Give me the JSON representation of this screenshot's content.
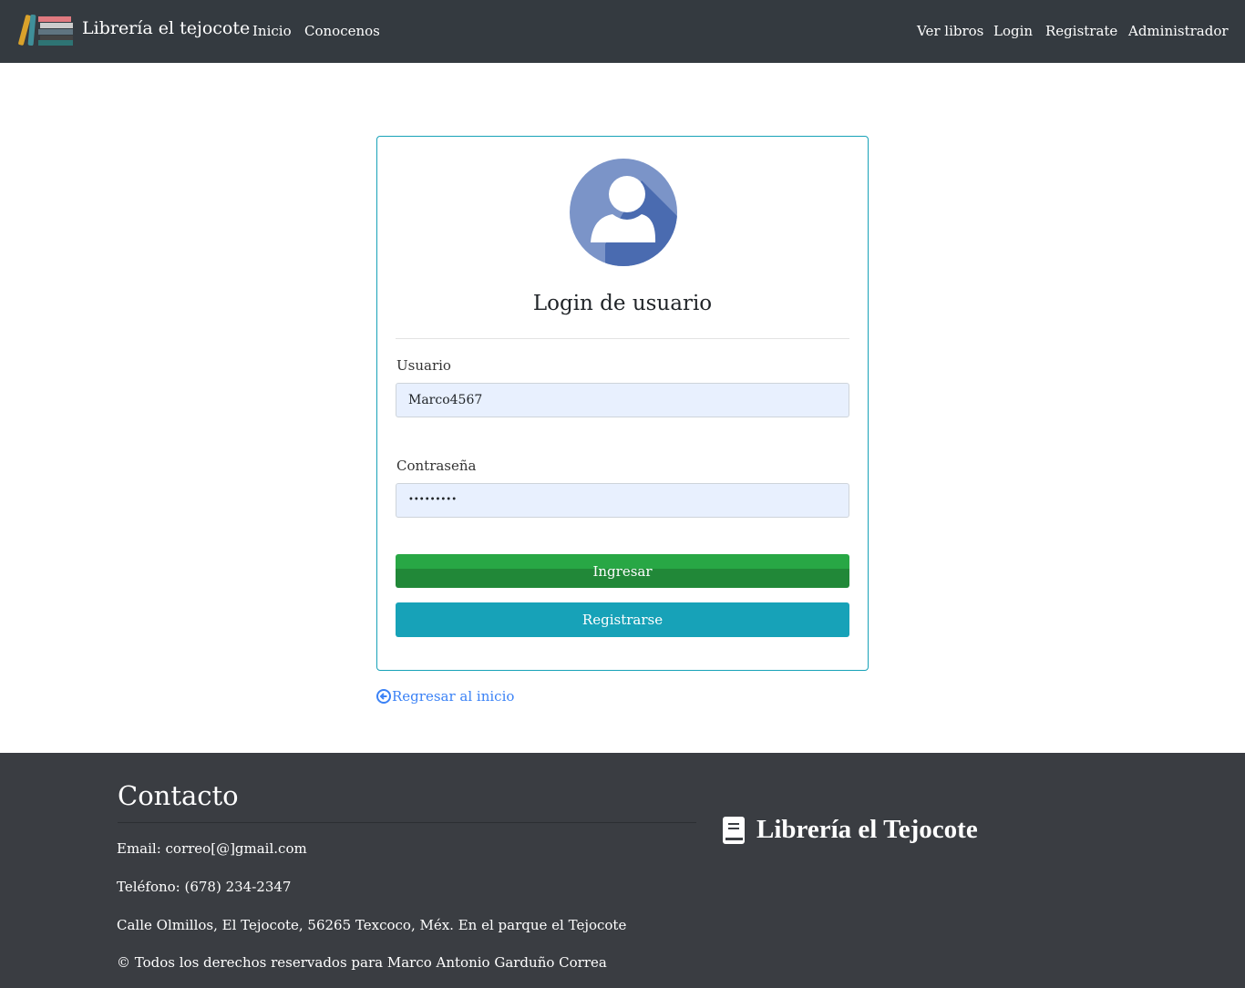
{
  "nav": {
    "brand": "Librería el tejocote",
    "left": [
      "Inicio",
      "Conocenos"
    ],
    "right": [
      "Ver libros",
      "Login",
      "Registrate",
      "Administrador"
    ]
  },
  "login": {
    "title": "Login de usuario",
    "user_label": "Usuario",
    "user_value": "Marco4567",
    "pass_label": "Contraseña",
    "pass_value": "•••••••••",
    "submit": "Ingresar",
    "register": "Registrarse",
    "back": "Regresar al inicio"
  },
  "footer": {
    "heading": "Contacto",
    "email": "Email: correo[@]gmail.com",
    "phone": "Teléfono: (678) 234-2347",
    "address": "Calle Olmillos, El Tejocote, 56265 Texcoco, Méx. En el parque el Tejocote",
    "copyright": "© Todos los derechos reservados para Marco Antonio Garduño Correa",
    "brand": "Librería el Tejocote"
  },
  "colors": {
    "nav": "#343a40",
    "success": "#28a745",
    "info": "#17a2b8",
    "footer": "#3a3d42",
    "link": "#3b82f6"
  }
}
